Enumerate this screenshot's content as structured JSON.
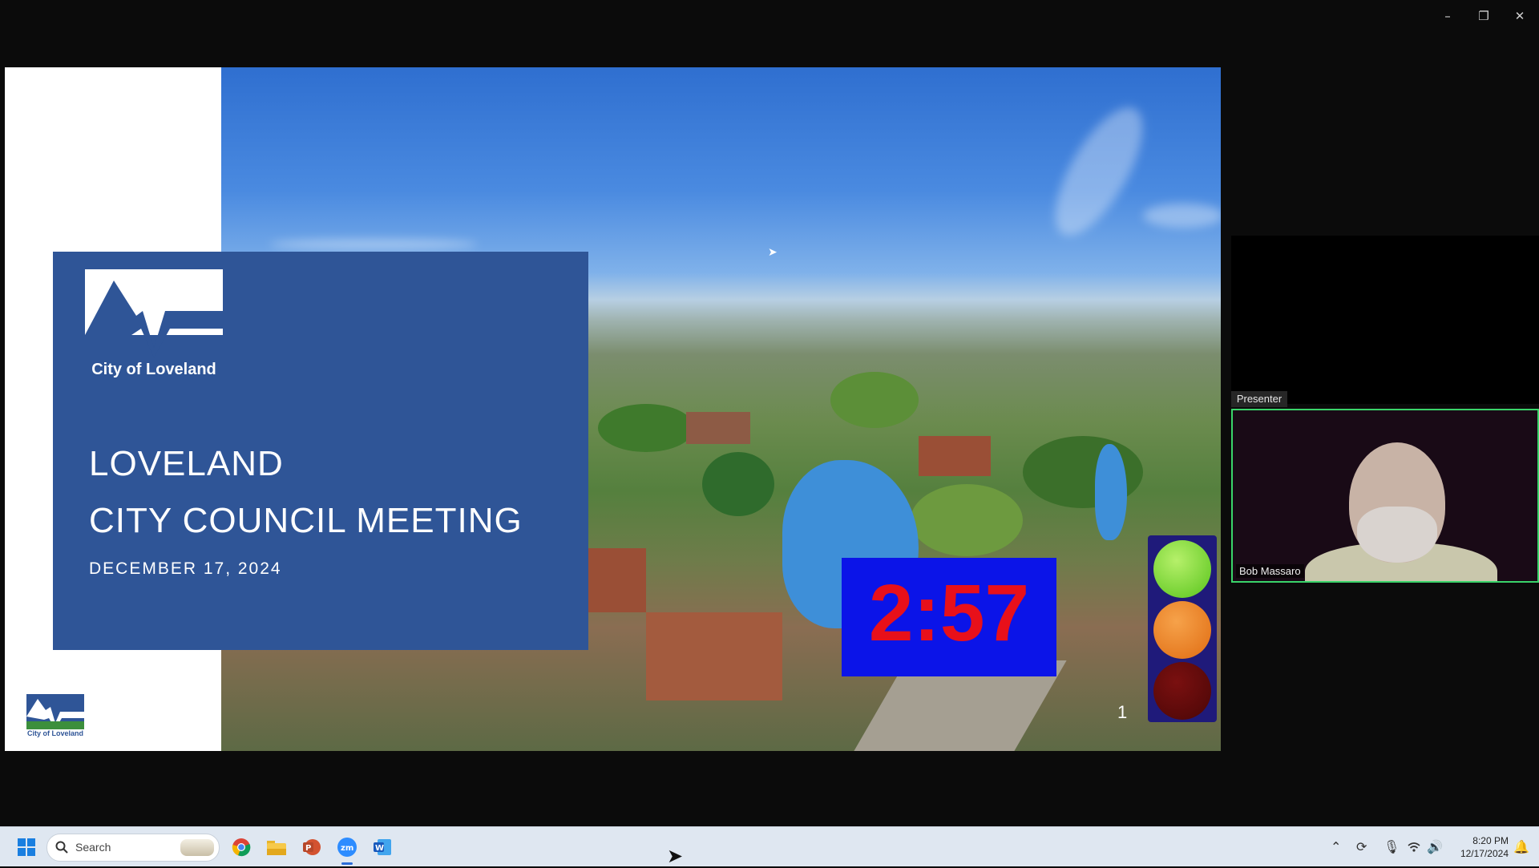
{
  "window": {
    "minimize": "–",
    "restore": "❐",
    "close": "✕"
  },
  "slide": {
    "logo_text": "City of Loveland",
    "title_line1": "LOVELAND",
    "title_line2": "CITY COUNCIL MEETING",
    "date": "DECEMBER 17, 2024",
    "small_logo_text": "City of Loveland",
    "slide_number": "1",
    "timer": "2:57",
    "traffic_light": {
      "green": "#7fdc2e",
      "amber": "#e87a18",
      "red": "#5c0a0a"
    }
  },
  "presenter_panel": {
    "label": "Presenter",
    "name": "Bob Massaro",
    "border_color": "#3ad46a"
  },
  "taskbar": {
    "search_placeholder": "Search",
    "clock_time": "8:20 PM",
    "clock_date": "12/17/2024",
    "apps": [
      "windows-start-icon",
      "chrome-icon",
      "file-explorer-icon",
      "powerpoint-icon",
      "zoom-icon",
      "word-icon"
    ]
  }
}
